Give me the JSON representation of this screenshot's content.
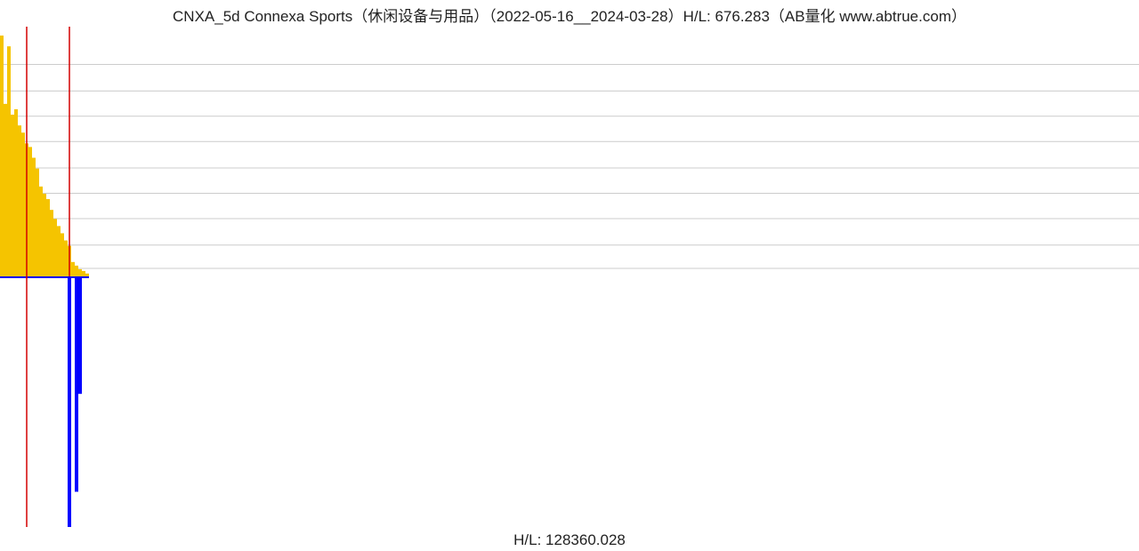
{
  "header": {
    "title": "CNXA_5d Connexa Sports（休闲设备与用品）（2022-05-16__2024-03-28）H/L: 676.283（AB量化  www.abtrue.com）"
  },
  "footer": {
    "label": "H/L: 128360.028"
  },
  "chart_data": {
    "type": "bar",
    "title": "CNXA_5d Connexa Sports（休闲设备与用品）（2022-05-16__2024-03-28）H/L: 676.283（AB量化  www.abtrue.com）",
    "x_range": [
      "2022-05-16",
      "2024-03-28"
    ],
    "upper_panel": {
      "description": "Price (yellow bars) with two red vertical markers",
      "hl_ratio": 676.283,
      "grid_levels_fraction_of_max": [
        0.033,
        0.13,
        0.24,
        0.345,
        0.45,
        0.56,
        0.665,
        0.77,
        0.88
      ],
      "red_marker_indices": [
        7,
        19
      ],
      "series": [
        {
          "name": "price",
          "color": "#f5c400",
          "values": [
            670,
            480,
            640,
            450,
            465,
            420,
            400,
            370,
            360,
            330,
            300,
            250,
            230,
            215,
            185,
            160,
            140,
            120,
            100,
            85,
            40,
            30,
            20,
            15,
            8,
            0,
            0,
            0,
            0,
            0,
            0,
            0,
            0,
            0,
            0,
            0,
            0,
            0,
            0,
            0,
            0,
            0,
            0,
            0,
            0,
            0,
            0,
            0,
            0,
            0,
            0,
            0,
            0,
            0,
            0,
            0,
            0,
            0,
            0,
            0,
            0,
            0,
            0,
            0,
            0,
            0,
            0,
            0,
            0,
            0,
            0,
            0,
            0,
            0,
            0,
            0,
            0,
            0,
            0,
            0,
            0,
            0,
            0,
            0,
            0,
            0,
            0,
            0,
            0,
            0,
            0,
            0,
            0,
            0,
            0,
            0,
            0,
            0,
            0,
            0,
            0,
            0,
            0,
            0,
            0,
            0,
            0,
            0,
            0,
            0,
            0,
            0,
            0,
            0,
            0,
            0,
            0,
            0,
            0,
            0,
            0,
            0,
            0,
            0,
            0,
            0,
            0,
            0,
            0,
            0,
            0,
            0,
            0,
            0,
            0,
            0,
            0,
            0,
            0,
            0,
            0,
            0,
            0,
            0,
            0,
            0,
            0,
            0,
            0,
            0,
            0,
            0,
            0,
            0,
            0,
            0,
            0,
            0,
            0,
            0,
            0,
            0,
            0,
            0,
            0,
            0,
            0,
            0,
            0,
            0,
            0,
            0,
            0,
            0,
            0,
            0,
            0,
            0,
            0,
            0,
            0,
            0,
            0,
            0,
            0,
            0,
            0,
            0,
            0,
            0,
            0,
            0,
            0,
            0,
            0,
            0,
            0,
            0,
            0,
            0,
            0,
            0,
            0,
            0,
            0,
            0,
            0,
            0,
            0,
            0,
            0,
            0,
            0,
            0,
            0,
            0,
            0,
            0,
            0,
            0,
            0,
            0,
            0,
            0,
            0,
            0,
            0,
            0,
            0,
            0,
            0,
            0,
            0,
            0,
            0,
            0,
            0,
            0,
            0,
            0,
            0,
            0,
            0,
            0,
            0,
            0,
            0,
            0,
            0,
            0,
            0,
            0,
            0,
            0,
            0,
            0,
            0,
            0,
            0,
            0,
            0,
            0,
            0,
            0,
            0,
            0,
            0,
            0,
            0,
            0,
            0,
            0,
            0,
            0,
            0,
            0,
            0,
            0,
            0,
            0,
            0,
            0,
            0,
            0,
            0,
            0,
            0,
            0,
            0,
            0,
            0,
            0,
            0,
            0,
            0,
            0,
            0,
            0,
            0,
            0,
            0,
            0,
            0,
            0,
            0,
            0,
            0,
            0,
            0,
            0,
            0,
            0,
            0,
            0,
            0,
            0,
            0,
            0,
            0,
            0
          ]
        }
      ]
    },
    "lower_panel": {
      "description": "Volume (blue bars, drawn downward) with one red vertical marker",
      "hl_ratio": 128360.028,
      "red_marker_indices": [
        7
      ],
      "series": [
        {
          "name": "volume",
          "color": "#0000ff",
          "values": [
            5,
            5,
            5,
            5,
            5,
            5,
            5,
            5,
            5,
            5,
            5,
            5,
            5,
            25,
            35,
            30,
            40,
            35,
            70,
            128000,
            90,
            110000,
            60000,
            15,
            5,
            0,
            0,
            0,
            0,
            0,
            0,
            0,
            0,
            0,
            0,
            0,
            0,
            0,
            0,
            0,
            0,
            0,
            0,
            0,
            0,
            0,
            0,
            0,
            0,
            0,
            0,
            0,
            0,
            0,
            0,
            0,
            0,
            0,
            0,
            0,
            0,
            0,
            0,
            0,
            0,
            0,
            0,
            0,
            0,
            0,
            0,
            0,
            0,
            0,
            0,
            0,
            0,
            0,
            0,
            0,
            0,
            0,
            0,
            0,
            0,
            0,
            0,
            0,
            0,
            0,
            0,
            0,
            0,
            0,
            0,
            0,
            0,
            0,
            0,
            0,
            0,
            0,
            0,
            0,
            0,
            0,
            0,
            0,
            0,
            0,
            0,
            0,
            0,
            0,
            0,
            0,
            0,
            0,
            0,
            0,
            0,
            0,
            0,
            0,
            0,
            0,
            0,
            0,
            0,
            0,
            0,
            0,
            0,
            0,
            0,
            0,
            0,
            0,
            0,
            0,
            0,
            0,
            0,
            0,
            0,
            0,
            0,
            0,
            0,
            0,
            0,
            0,
            0,
            0,
            0,
            0,
            0,
            0,
            0,
            0,
            0,
            0,
            0,
            0,
            0,
            0,
            0,
            0,
            0,
            0,
            0,
            0,
            0,
            0,
            0,
            0,
            0,
            0,
            0,
            0,
            0,
            0,
            0,
            0,
            0,
            0,
            0,
            0,
            0,
            0,
            0,
            0,
            0,
            0,
            0,
            0,
            0,
            0,
            0,
            0,
            0,
            0,
            0,
            0,
            0,
            0,
            0,
            0,
            0,
            0,
            0,
            0,
            0,
            0,
            0,
            0,
            0,
            0,
            0,
            0,
            0,
            0,
            0,
            0,
            0,
            0,
            0,
            0,
            0,
            0,
            0,
            0,
            0,
            0,
            0,
            0,
            0,
            0,
            0,
            0,
            0,
            0,
            0,
            0,
            0,
            0,
            0,
            0,
            0,
            0,
            0,
            0,
            0,
            0,
            0,
            0,
            0,
            0,
            0,
            0,
            0,
            0,
            0,
            0,
            0,
            0,
            0,
            0,
            0,
            0,
            0,
            0,
            0,
            0,
            0,
            0,
            0,
            0,
            0,
            0,
            0,
            0,
            0,
            0,
            0,
            0,
            0,
            0,
            0,
            0,
            0,
            0,
            0,
            0,
            0,
            0,
            0,
            0,
            0,
            0,
            0,
            0,
            0,
            0,
            0,
            0,
            0,
            0,
            0,
            0,
            0,
            0,
            0,
            0,
            0,
            0,
            0,
            0,
            0,
            0
          ]
        }
      ]
    }
  }
}
